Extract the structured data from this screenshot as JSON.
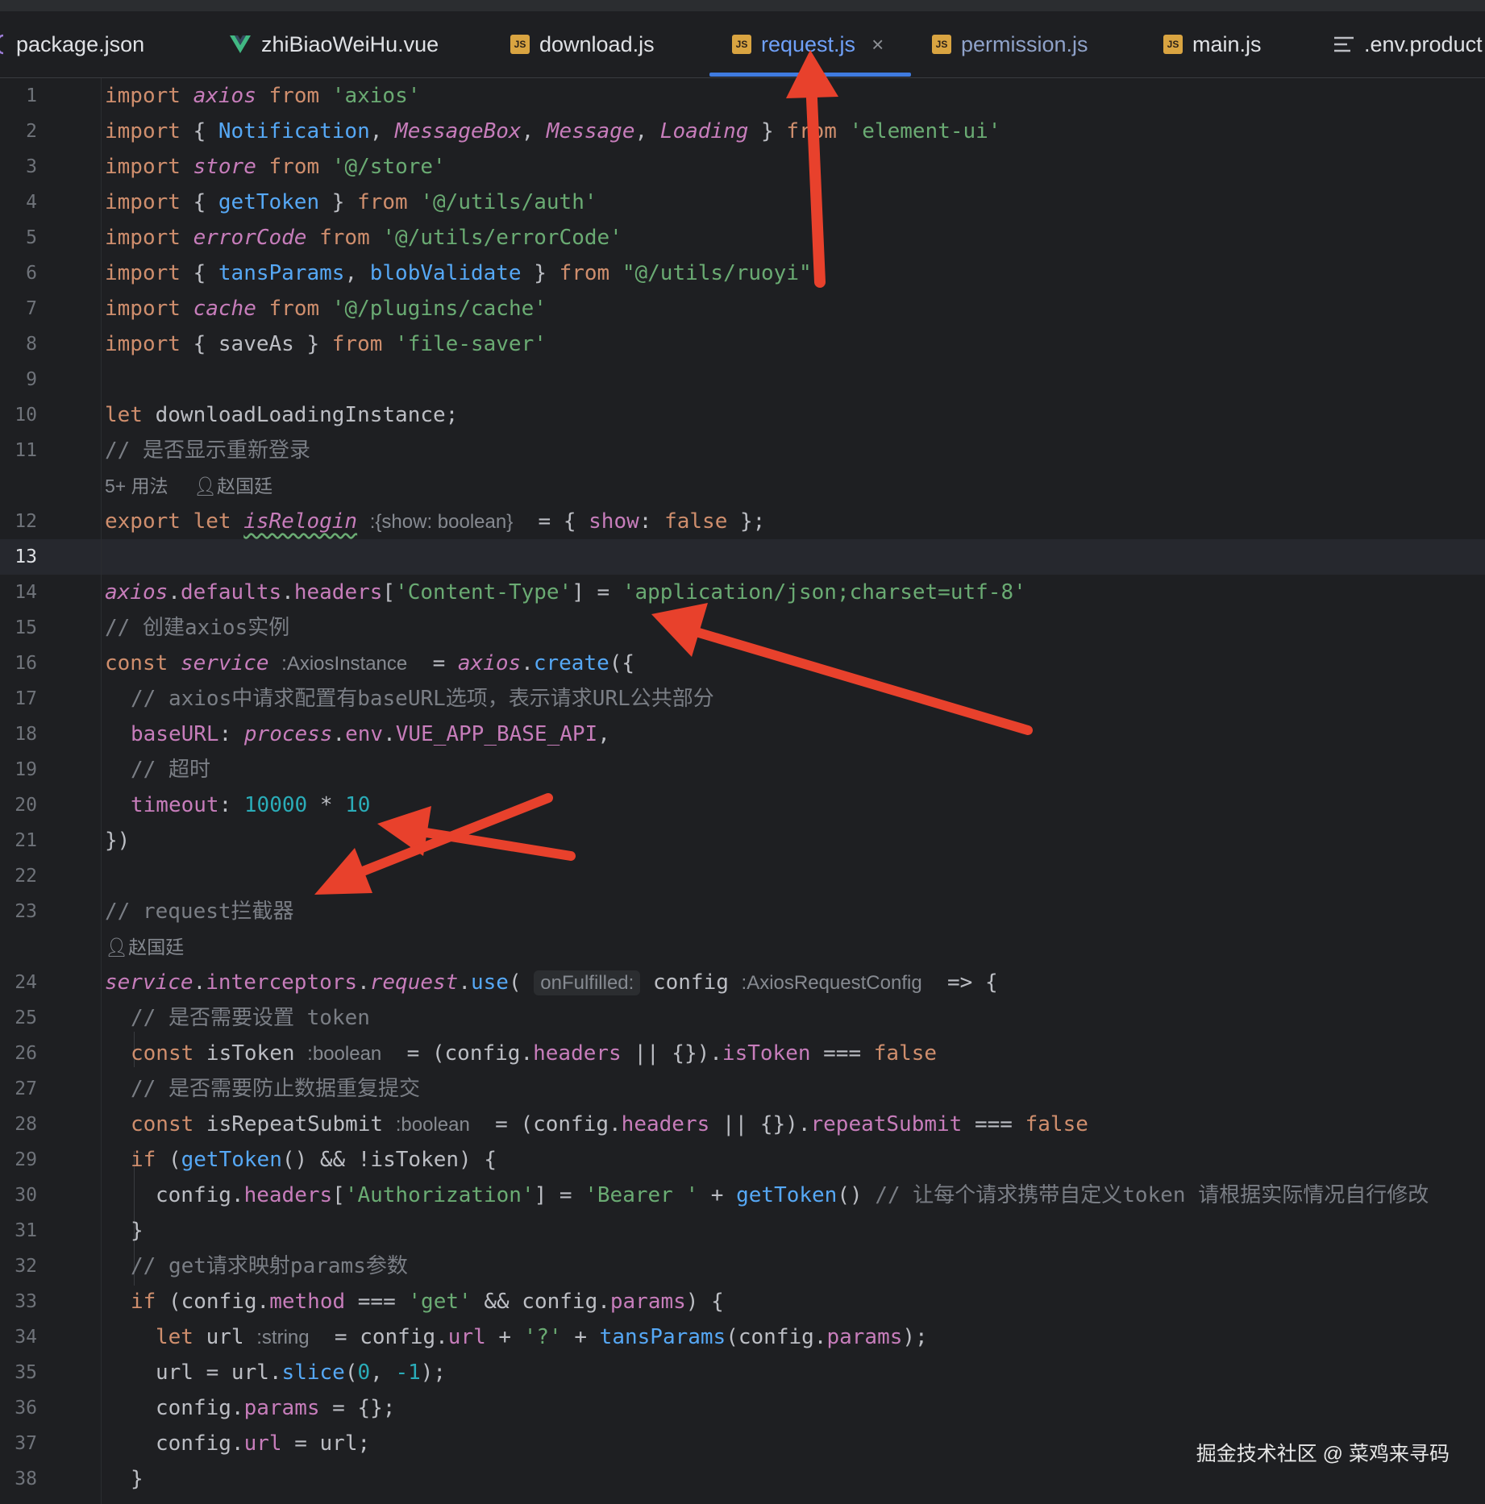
{
  "tabs": [
    {
      "icon": "json-icon",
      "label": "package.json"
    },
    {
      "icon": "vue-icon",
      "label": "zhiBiaoWeiHu.vue"
    },
    {
      "icon": "js-icon",
      "label": "download.js"
    },
    {
      "icon": "js-icon",
      "label": "request.js",
      "active": true,
      "close": "×"
    },
    {
      "icon": "js-icon",
      "label": "permission.js"
    },
    {
      "icon": "js-icon",
      "label": "main.js"
    },
    {
      "icon": "env-icon",
      "label": ".env.product"
    }
  ],
  "icon_text": {
    "js": "JS"
  },
  "line_numbers": [
    "1",
    "2",
    "3",
    "4",
    "5",
    "6",
    "7",
    "8",
    "9",
    "10",
    "11",
    "12",
    "13",
    "14",
    "15",
    "16",
    "17",
    "18",
    "19",
    "20",
    "21",
    "22",
    "23",
    "24",
    "25",
    "26",
    "27",
    "28",
    "29",
    "30",
    "31",
    "32",
    "33",
    "34",
    "35",
    "36",
    "37",
    "38"
  ],
  "code": {
    "l1": "import axios from 'axios'",
    "l2": "import { Notification, MessageBox, Message, Loading } from 'element-ui'",
    "l3": "import store from '@/store'",
    "l4": "import { getToken } from '@/utils/auth'",
    "l5": "import errorCode from '@/utils/errorCode'",
    "l6": "import { tansParams, blobValidate } from \"@/utils/ruoyi\";",
    "l7": "import cache from '@/plugins/cache'",
    "l8": "import { saveAs } from 'file-saver'",
    "l10": "let downloadLoadingInstance;",
    "l11": "// 是否显示重新登录",
    "usage_hint": "5+ 用法",
    "author": "赵国廷",
    "l12_type_hint": ":{show: boolean}",
    "l14": "axios.defaults.headers['Content-Type'] = 'application/json;charset=utf-8'",
    "l15": "// 创建axios实例",
    "l16_type_hint": ":AxiosInstance",
    "l17": "// axios中请求配置有baseURL选项，表示请求URL公共部分",
    "l18": "baseURL: process.env.VUE_APP_BASE_API,",
    "l19": "// 超时",
    "l20": "timeout: 10000 * 10",
    "l21": "})",
    "l23": "// request拦截器",
    "l24_param_hint": "onFulfilled:",
    "l24_type_hint": ":AxiosRequestConfig",
    "l25": "// 是否需要设置 token",
    "bool_hint": ":boolean",
    "l27": "// 是否需要防止数据重复提交",
    "l30_comment": "// 让每个请求携带自定义token 请根据实际情况自行修改",
    "l32": "// get请求映射params参数",
    "string_hint": ":string"
  },
  "watermark": "掘金技术社区 @ 菜鸡来寻码",
  "colors": {
    "background": "#1e1f22",
    "keyword": "#cf8e6d",
    "string": "#6aab73",
    "number": "#2aacb8",
    "comment": "#7a7e85",
    "function": "#56a8f5",
    "identifier_italic": "#c77dbb",
    "active_tab": "#6fa0f8",
    "annotation_arrow": "#e8412c"
  }
}
